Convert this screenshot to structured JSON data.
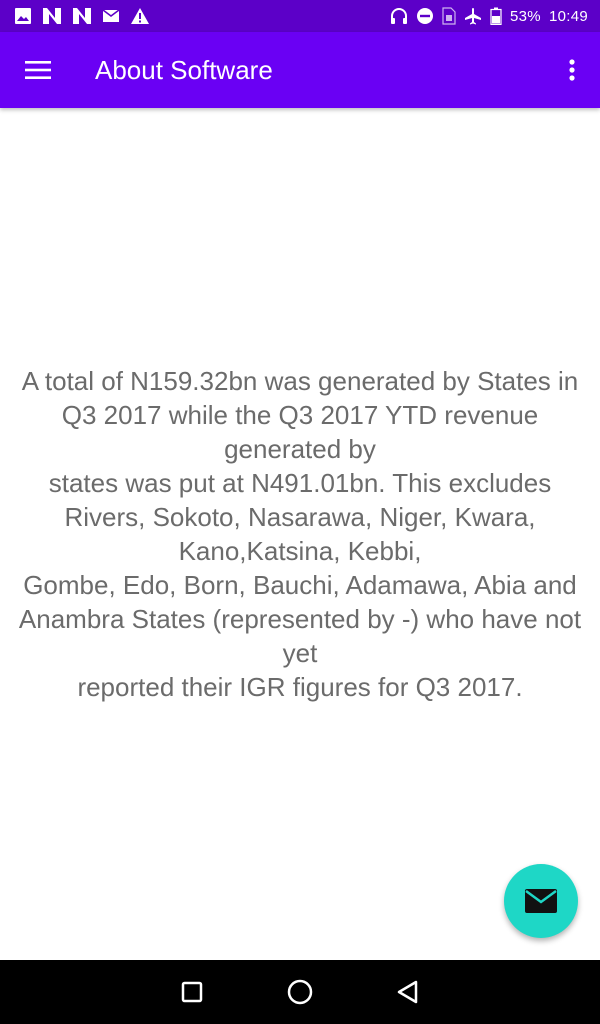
{
  "status_bar": {
    "left_icons": [
      "image-icon",
      "n-app-icon",
      "n-app-icon",
      "mail-muted-icon",
      "warning-icon"
    ],
    "right_icons": [
      "headphones-icon",
      "do-not-disturb-icon",
      "sim-icon",
      "airplane-icon",
      "battery-icon"
    ],
    "battery": "53%",
    "time": "10:49"
  },
  "app_bar": {
    "title": "About Software",
    "menu_icon": "hamburger-menu-icon",
    "overflow_icon": "more-vert-icon",
    "color": "#6a00f4"
  },
  "content": {
    "text": "A total of N159.32bn was generated by States in Q3 2017 while the Q3 2017 YTD revenue generated by\nstates was put at N491.01bn. This excludes Rivers, Sokoto, Nasarawa, Niger, Kwara, Kano,Katsina, Kebbi,\nGombe, Edo, Born, Bauchi, Adamawa, Abia and Anambra States (represented by -) who have not yet\nreported their IGR figures for Q3 2017."
  },
  "fab": {
    "icon": "email-icon",
    "color": "#1ed7c6"
  },
  "nav_bar": {
    "buttons": [
      "recents-square-icon",
      "home-circle-icon",
      "back-triangle-icon"
    ]
  }
}
